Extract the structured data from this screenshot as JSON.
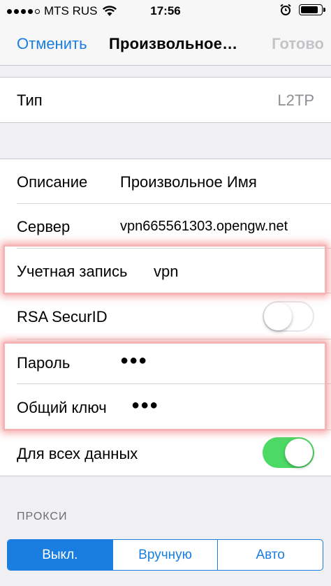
{
  "status_bar": {
    "carrier": "MTS RUS",
    "time": "17:56",
    "battery_level": 0.9
  },
  "nav": {
    "cancel": "Отменить",
    "title": "Произвольное…",
    "done": "Готово"
  },
  "type_row": {
    "label": "Тип",
    "value": "L2TP"
  },
  "fields": {
    "description": {
      "label": "Описание",
      "value": "Произвольное Имя"
    },
    "server": {
      "label": "Сервер",
      "value": "vpn665561303.opengw.net"
    },
    "account": {
      "label": "Учетная запись",
      "value": "vpn"
    },
    "rsa": {
      "label": "RSA SecurID",
      "enabled": false
    },
    "password": {
      "label": "Пароль",
      "value": "●●●"
    },
    "shared_key": {
      "label": "Общий ключ",
      "value": "●●●"
    },
    "send_all": {
      "label": "Для всех данных",
      "enabled": true
    }
  },
  "proxy": {
    "header": "ПРОКСИ",
    "options": [
      "Выкл.",
      "Вручную",
      "Авто"
    ],
    "selected_index": 0
  },
  "colors": {
    "accent": "#1a7de0",
    "toggle_on": "#4cd964",
    "highlight": "#f08080"
  }
}
